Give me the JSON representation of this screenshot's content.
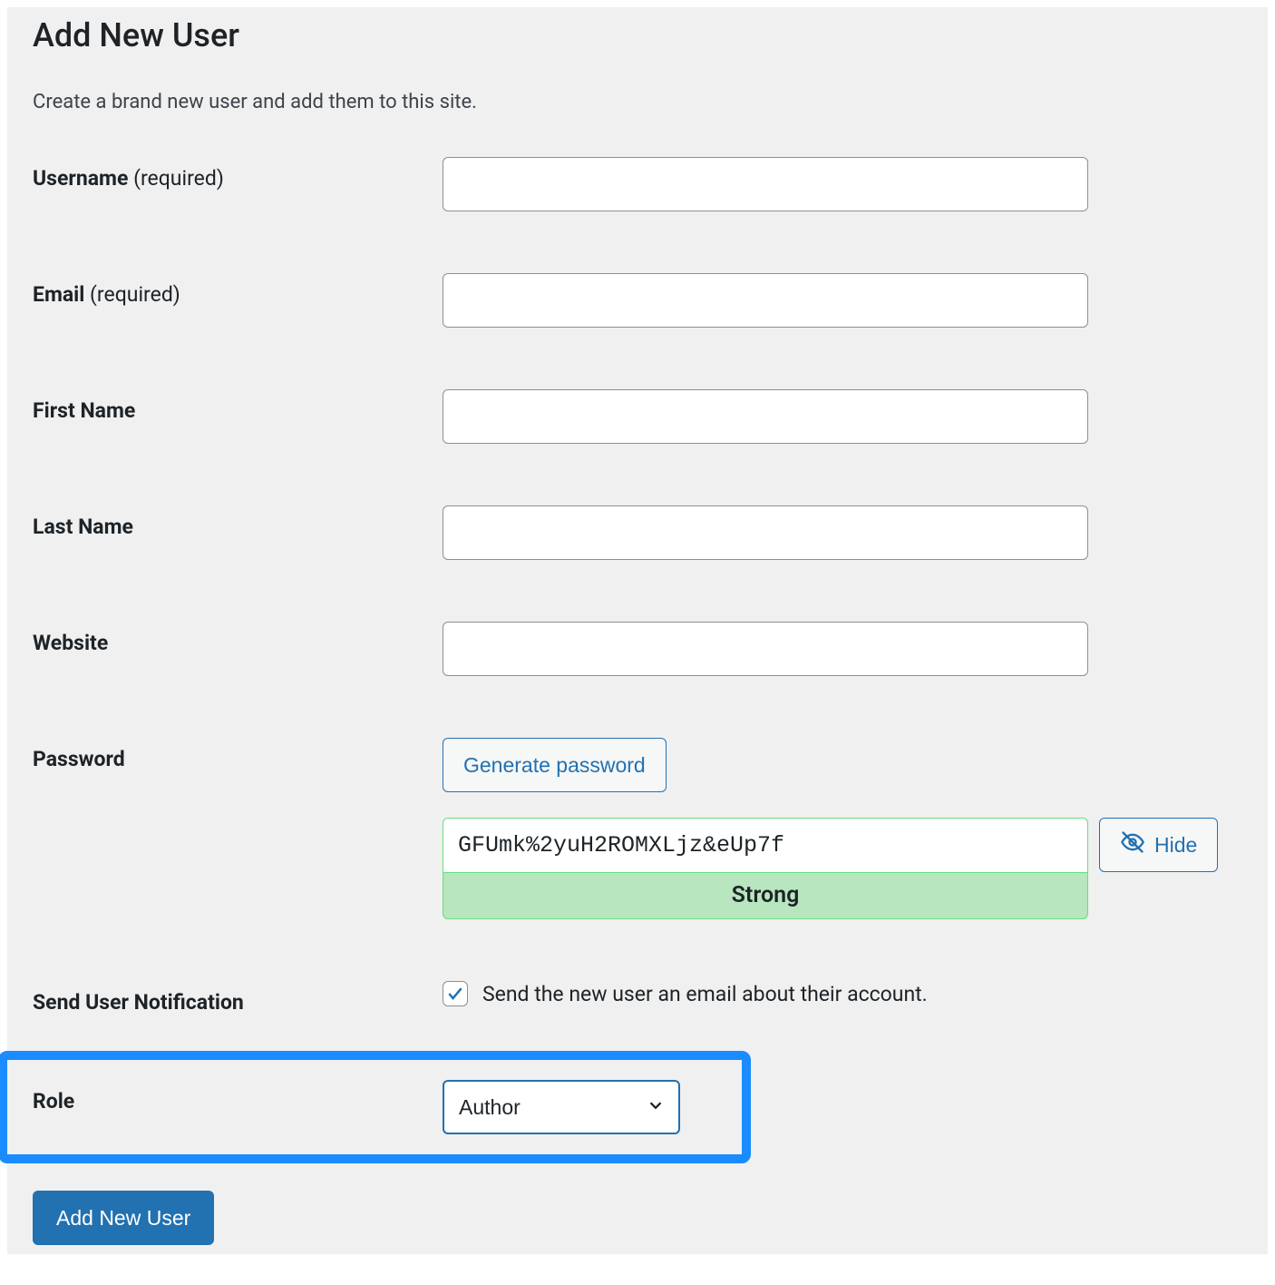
{
  "page": {
    "title": "Add New User",
    "subtitle": "Create a brand new user and add them to this site."
  },
  "fields": {
    "username": {
      "label": "Username",
      "required_suffix": " (required)",
      "value": ""
    },
    "email": {
      "label": "Email",
      "required_suffix": " (required)",
      "value": ""
    },
    "first_name": {
      "label": "First Name",
      "value": ""
    },
    "last_name": {
      "label": "Last Name",
      "value": ""
    },
    "website": {
      "label": "Website",
      "value": ""
    },
    "password": {
      "label": "Password",
      "generate_button": "Generate password",
      "value": "GFUmk%2yuH2ROMXLjz&eUp7f",
      "strength": "Strong",
      "hide_button": "Hide"
    },
    "notification": {
      "label": "Send User Notification",
      "checkbox_label": "Send the new user an email about their account.",
      "checked": true
    },
    "role": {
      "label": "Role",
      "selected": "Author"
    }
  },
  "actions": {
    "submit": "Add New User"
  }
}
